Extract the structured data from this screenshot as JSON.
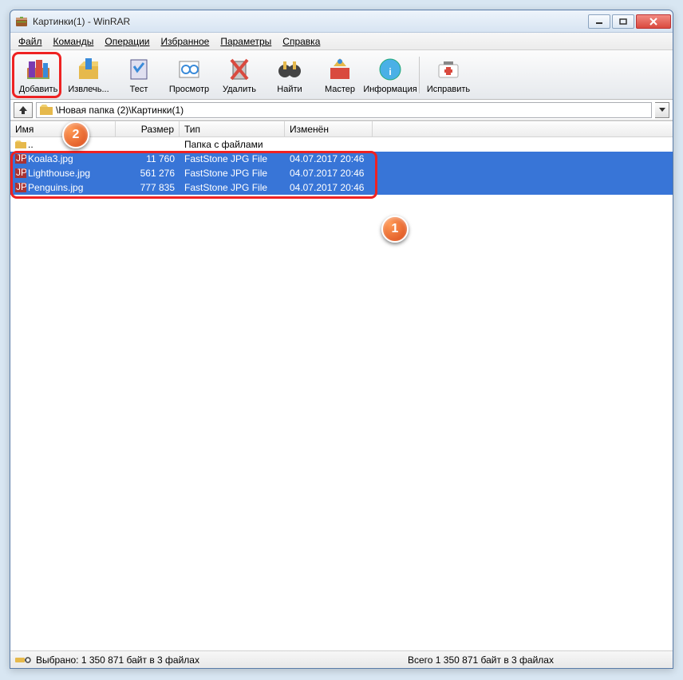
{
  "window": {
    "title": "Картинки(1) - WinRAR"
  },
  "menu": {
    "file": "Файл",
    "commands": "Команды",
    "operations": "Операции",
    "favorites": "Избранное",
    "options": "Параметры",
    "help": "Справка"
  },
  "toolbar": {
    "add": "Добавить",
    "extract": "Извлечь...",
    "test": "Тест",
    "view": "Просмотр",
    "delete": "Удалить",
    "find": "Найти",
    "wizard": "Мастер",
    "info": "Информация",
    "repair": "Исправить"
  },
  "address": {
    "path": "\\Новая папка (2)\\Картинки(1)"
  },
  "columns": {
    "name": "Имя",
    "size": "Размер",
    "type": "Тип",
    "modified": "Изменён"
  },
  "parent_row": {
    "name": "..",
    "type": "Папка с файлами"
  },
  "files": [
    {
      "name": "Koala3.jpg",
      "size": "11 760",
      "type": "FastStone JPG File",
      "modified": "04.07.2017 20:46"
    },
    {
      "name": "Lighthouse.jpg",
      "size": "561 276",
      "type": "FastStone JPG File",
      "modified": "04.07.2017 20:46"
    },
    {
      "name": "Penguins.jpg",
      "size": "777 835",
      "type": "FastStone JPG File",
      "modified": "04.07.2017 20:46"
    }
  ],
  "status": {
    "selected": "Выбрано: 1 350 871 байт в 3 файлах",
    "total": "Всего 1 350 871 байт в 3 файлах"
  },
  "callouts": {
    "one": "1",
    "two": "2"
  }
}
